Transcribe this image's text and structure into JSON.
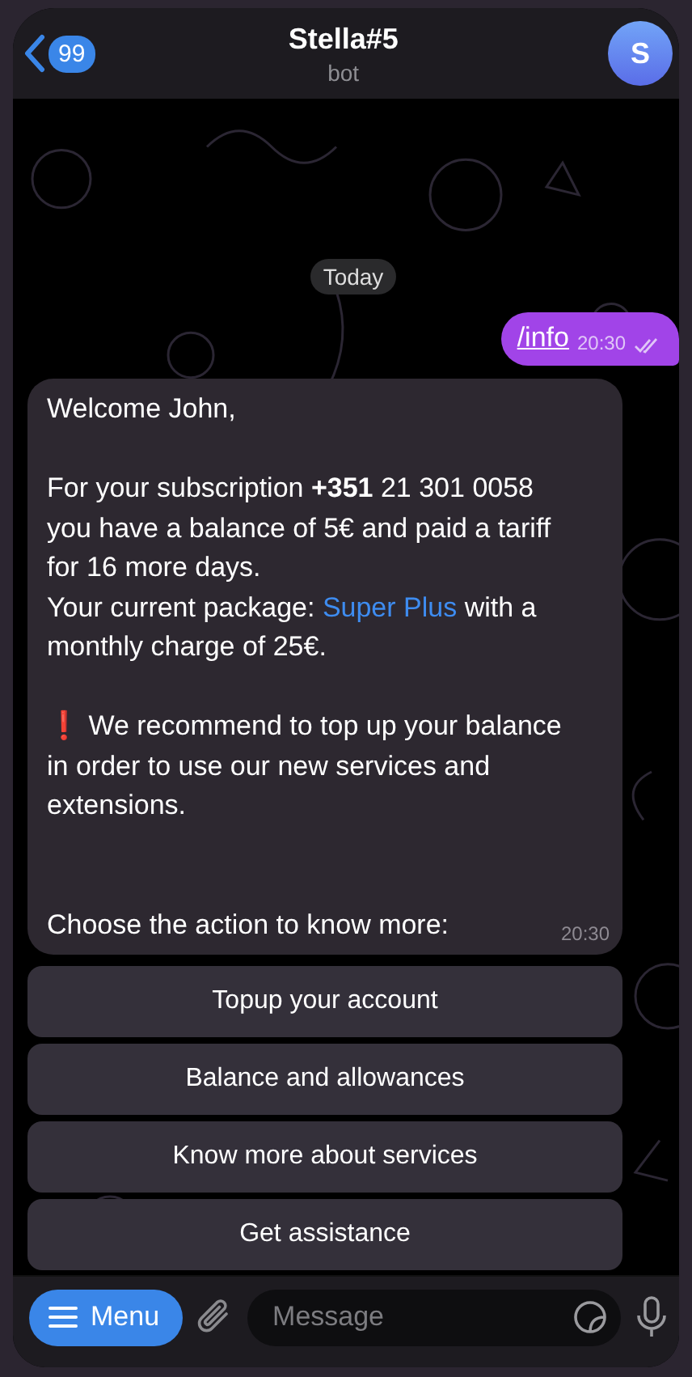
{
  "header": {
    "back_count": "99",
    "title": "Stella#5",
    "subtitle": "bot",
    "avatar_letter": "S"
  },
  "date_chip": "Today",
  "outgoing": {
    "text": "/info",
    "time": "20:30",
    "read": true
  },
  "incoming": {
    "paragraphs": [
      {
        "parts": [
          {
            "kind": "text",
            "text": "Welcome John,"
          }
        ]
      },
      {
        "parts": [
          {
            "kind": "text",
            "text": "For your subscription **+351** 21 301 0058 you have a balance of 5€ and paid a tariff for 16 more days.\nYour current package: "
          },
          {
            "kind": "link",
            "text": "Super Plus"
          },
          {
            "kind": "text",
            "text": " with a monthly charge of 25€."
          }
        ]
      },
      {
        "parts": [
          {
            "kind": "text",
            "text": "❗ We recommend to top up your balance in order to use our new services and extensions."
          }
        ]
      }
    ],
    "last_line": "Choose the action to know more:",
    "time": "20:30"
  },
  "keyboard": [
    "Topup your account",
    "Balance and allowances",
    "Know more about services",
    "Get assistance"
  ],
  "input": {
    "menu_label": "Menu",
    "placeholder": "Message"
  }
}
